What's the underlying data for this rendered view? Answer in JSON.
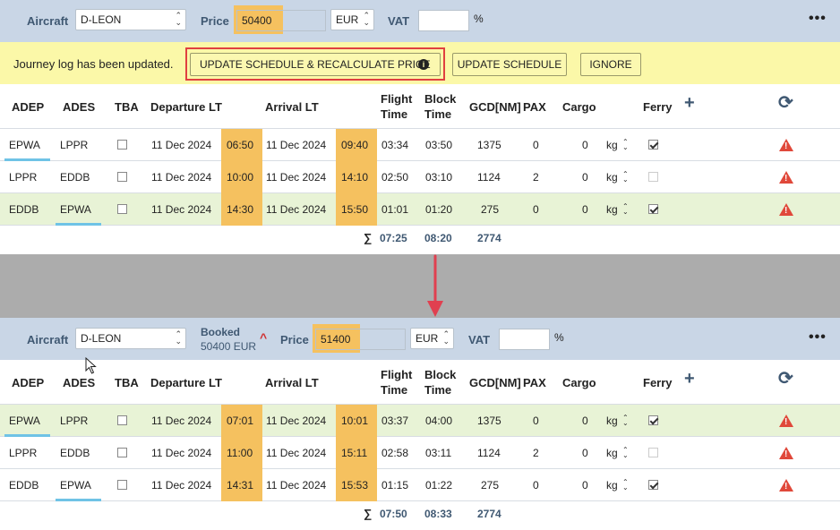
{
  "top": {
    "aircraft_label": "Aircraft",
    "aircraft_value": "D-LEON",
    "price_label": "Price",
    "price_value": "50400",
    "currency": "EUR",
    "vat_label": "VAT",
    "vat_unit": "%"
  },
  "notice": {
    "message": "Journey log has been updated.",
    "btn_recalc": "UPDATE SCHEDULE & RECALCULATE PRICE",
    "btn_update": "UPDATE SCHEDULE",
    "btn_ignore": "IGNORE"
  },
  "headers": {
    "adep": "ADEP",
    "ades": "ADES",
    "tba": "TBA",
    "dep": "Departure LT",
    "arr": "Arrival LT",
    "flight": "Flight",
    "flight2": "Time",
    "block": "Block",
    "block2": "Time",
    "gcd": "GCD[NM]",
    "pax": "PAX",
    "cargo": "Cargo",
    "ferry": "Ferry"
  },
  "table1": {
    "rows": [
      {
        "adep": "EPWA",
        "ades": "LPPR",
        "dep_date": "11 Dec 2024",
        "dep_time": "06:50",
        "arr_date": "11 Dec 2024",
        "arr_time": "09:40",
        "flight": "03:34",
        "block": "03:50",
        "gcd": "1375",
        "pax": "0",
        "cargo": "0",
        "unit": "kg"
      },
      {
        "adep": "LPPR",
        "ades": "EDDB",
        "dep_date": "11 Dec 2024",
        "dep_time": "10:00",
        "arr_date": "11 Dec 2024",
        "arr_time": "14:10",
        "flight": "02:50",
        "block": "03:10",
        "gcd": "1124",
        "pax": "2",
        "cargo": "0",
        "unit": "kg"
      },
      {
        "adep": "EDDB",
        "ades": "EPWA",
        "dep_date": "11 Dec 2024",
        "dep_time": "14:30",
        "arr_date": "11 Dec 2024",
        "arr_time": "15:50",
        "flight": "01:01",
        "block": "01:20",
        "gcd": "275",
        "pax": "0",
        "cargo": "0",
        "unit": "kg"
      }
    ],
    "sum_symbol": "∑",
    "sum_flight": "07:25",
    "sum_block": "08:20",
    "sum_gcd": "2774"
  },
  "bottom": {
    "aircraft_label": "Aircraft",
    "aircraft_value": "D-LEON",
    "booked_label": "Booked",
    "booked_value": "50400 EUR",
    "price_label": "Price",
    "price_value": "51400",
    "currency": "EUR",
    "vat_label": "VAT",
    "vat_unit": "%"
  },
  "table2": {
    "rows": [
      {
        "adep": "EPWA",
        "ades": "LPPR",
        "dep_date": "11 Dec 2024",
        "dep_time": "07:01",
        "arr_date": "11 Dec 2024",
        "arr_time": "10:01",
        "flight": "03:37",
        "block": "04:00",
        "gcd": "1375",
        "pax": "0",
        "cargo": "0",
        "unit": "kg"
      },
      {
        "adep": "LPPR",
        "ades": "EDDB",
        "dep_date": "11 Dec 2024",
        "dep_time": "11:00",
        "arr_date": "11 Dec 2024",
        "arr_time": "15:11",
        "flight": "02:58",
        "block": "03:11",
        "gcd": "1124",
        "pax": "2",
        "cargo": "0",
        "unit": "kg"
      },
      {
        "adep": "EDDB",
        "ades": "EPWA",
        "dep_date": "11 Dec 2024",
        "dep_time": "14:31",
        "arr_date": "11 Dec 2024",
        "arr_time": "15:53",
        "flight": "01:15",
        "block": "01:22",
        "gcd": "275",
        "pax": "0",
        "cargo": "0",
        "unit": "kg"
      }
    ],
    "sum_symbol": "∑",
    "sum_flight": "07:50",
    "sum_block": "08:33",
    "sum_gcd": "2774"
  },
  "icons": {
    "more": "more-icon",
    "add": "plus-icon",
    "refresh": "refresh-icon",
    "warning": "warning-icon",
    "info": "info-icon",
    "arrow": "down-arrow-icon",
    "cursor": "mouse-cursor-icon"
  },
  "colors": {
    "highlight": "#f5c15f",
    "green_row": "#e8f3d6",
    "notice": "#fbf8a8",
    "alert": "#e04040",
    "header_bar": "#c9d6e6"
  }
}
